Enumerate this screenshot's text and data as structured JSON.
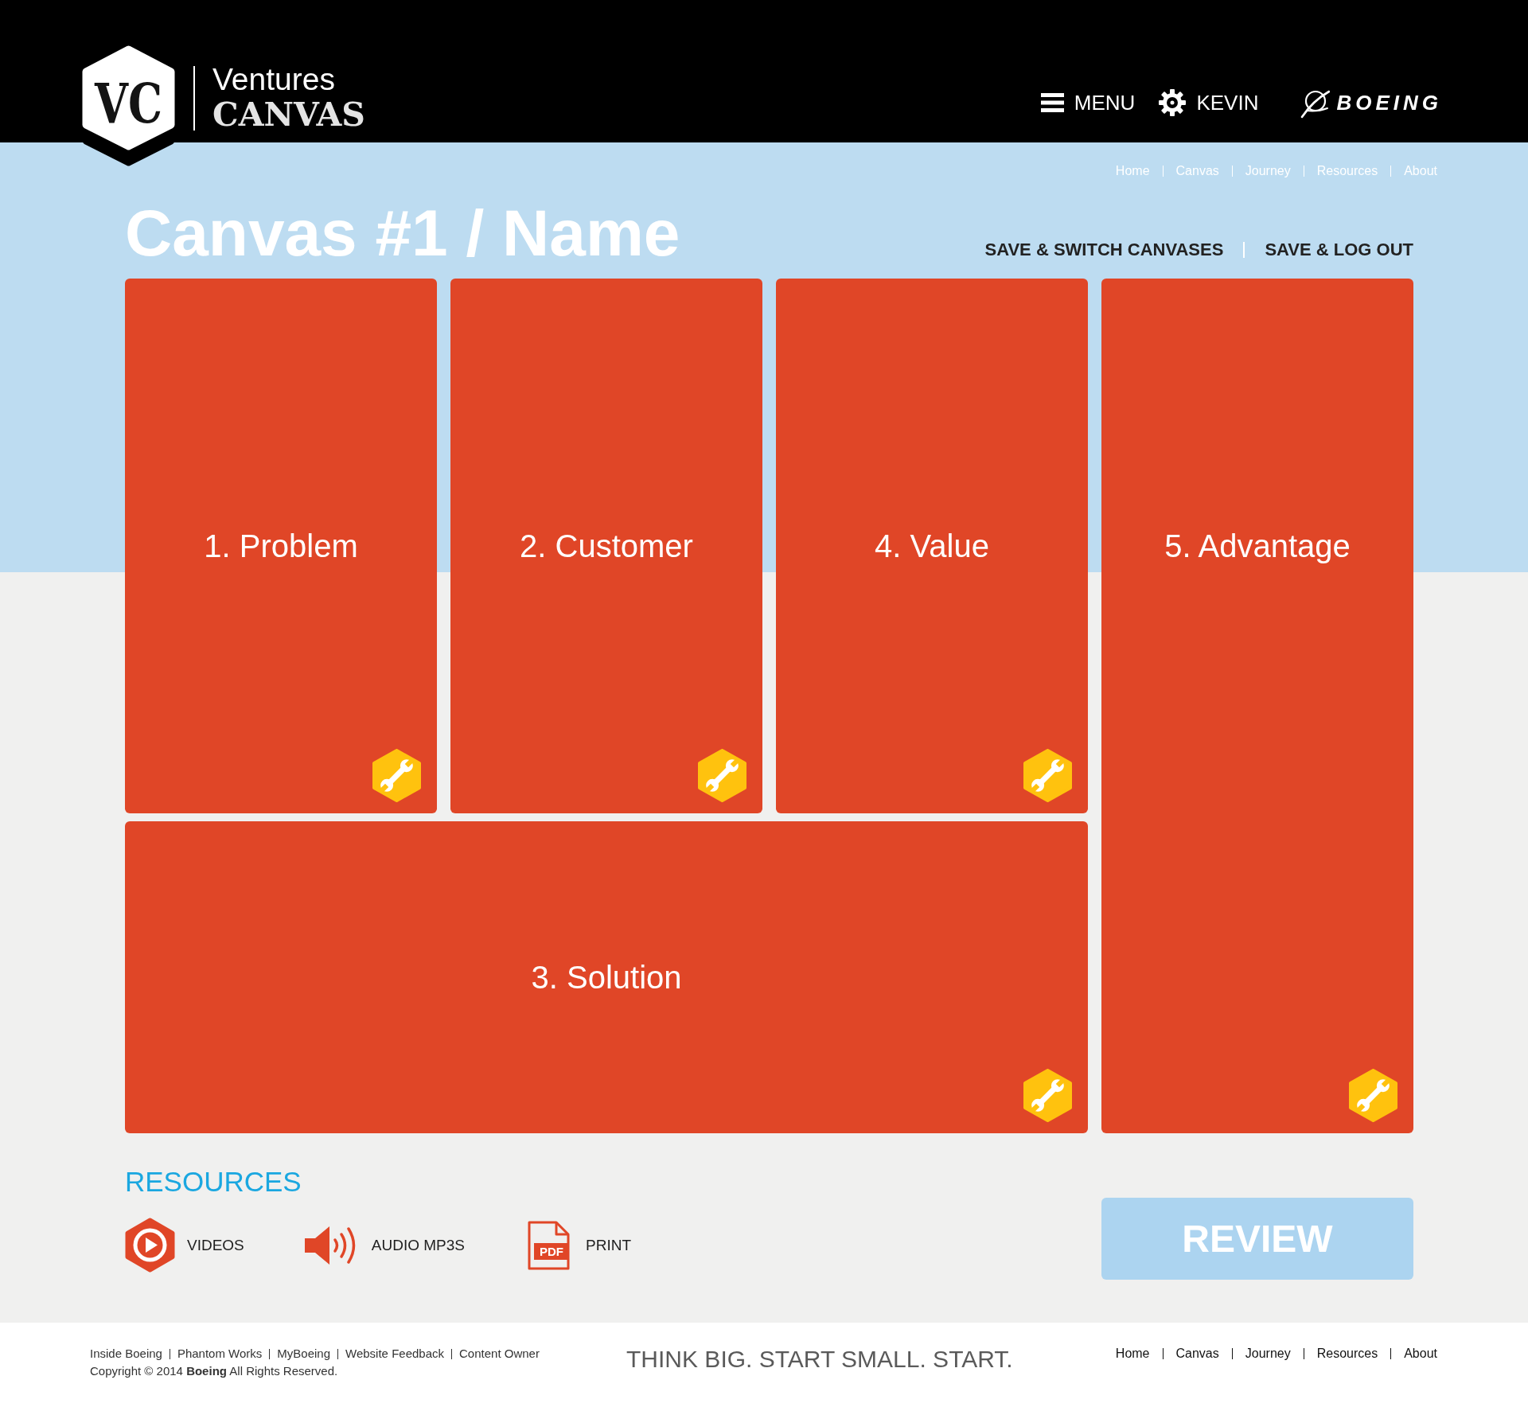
{
  "header": {
    "logo": {
      "badge": "VC",
      "line_1": "Ventures",
      "line_2": "CANVAS"
    },
    "menu": "MENU",
    "user": "KEVIN",
    "brand": "BOEING"
  },
  "breadcrumb": [
    "Home",
    "Canvas",
    "Journey",
    "Resources",
    "About"
  ],
  "title": "Canvas #1 / Name",
  "actions": [
    "SAVE & SWITCH CANVASES",
    "SAVE & LOG OUT"
  ],
  "cards": [
    {
      "label": "1. Problem",
      "kind": "box"
    },
    {
      "label": "2. Customer",
      "kind": "box"
    },
    {
      "label": "4. Value",
      "kind": "box"
    },
    {
      "label": "5. Advantage",
      "kind": "tall"
    },
    {
      "label": "3. Solution",
      "kind": "wide"
    }
  ],
  "resources": {
    "heading": "RESOURCES",
    "items": [
      {
        "label": "VIDEOS",
        "kind": "video"
      },
      {
        "label": "AUDIO MP3S",
        "kind": "audio"
      },
      {
        "label": "PRINT",
        "kind": "pdf",
        "badge": "PDF"
      }
    ]
  },
  "review_button": "REVIEW",
  "footer": {
    "links": [
      "Inside Boeing",
      "Phantom Works",
      "MyBoeing",
      "Website Feedback",
      "Content Owner"
    ],
    "copyright": "Copyright © 2014 **Boeing** All Rights Reserved.",
    "tagline": "THINK BIG. START SMALL. START.",
    "nav": [
      "Home",
      "Canvas",
      "Journey",
      "Resources",
      "About"
    ]
  }
}
